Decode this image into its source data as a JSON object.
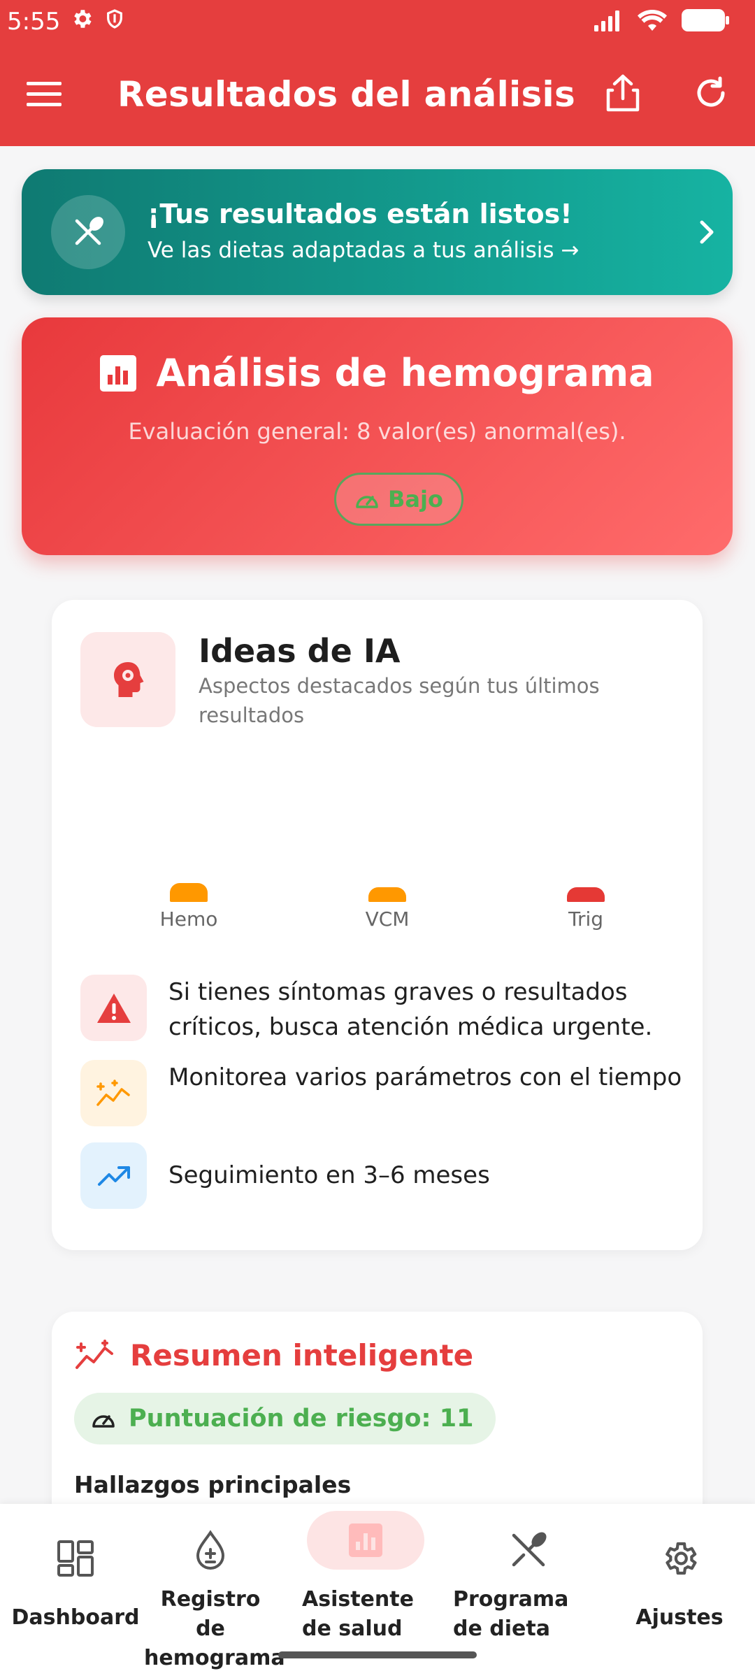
{
  "status_bar": {
    "time": "5:55"
  },
  "app_bar": {
    "title": "Resultados del análisis"
  },
  "banner": {
    "title": "¡Tus resultados están listos!",
    "subtitle": "Ve las dietas adaptadas a tus análisis →"
  },
  "analysis_card": {
    "title": "Análisis de hemograma",
    "subtitle": "Evaluación general: 8 valor(es) anormal(es).",
    "badge": "Bajo"
  },
  "ai_ideas": {
    "title": "Ideas de IA",
    "subtitle": "Aspectos destacados según tus últimos resultados",
    "chart_data": {
      "type": "bar",
      "categories": [
        "Hemo",
        "VCM",
        "Trig"
      ],
      "values": [
        0.45,
        0.35,
        0.35
      ],
      "colors": [
        "#ff9800",
        "#ff9800",
        "#e53935"
      ]
    },
    "tips": [
      {
        "icon": "warning-icon",
        "text": "Si tienes síntomas graves o resultados críticos, busca atención médica urgente."
      },
      {
        "icon": "trend-sparkle-icon",
        "text": "Monitorea varios parámetros con el tiempo"
      },
      {
        "icon": "trending-up-icon",
        "text": "Seguimiento en 3–6 meses"
      }
    ]
  },
  "smart_summary": {
    "title": "Resumen inteligente",
    "risk_score": "Puntuación de riesgo: 11",
    "findings_heading": "Hallazgos principales"
  },
  "bottom_nav": {
    "items": [
      {
        "label": "Dashboard",
        "icon": "dashboard-icon"
      },
      {
        "label": "Registro de hemograma",
        "icon": "blood-drop-icon"
      },
      {
        "label": "Asistente de salud",
        "icon": "chart-icon"
      },
      {
        "label": "Programa de dieta",
        "icon": "fork-knife-icon"
      },
      {
        "label": "Ajustes",
        "icon": "gear-icon"
      }
    ],
    "active_index": 2
  },
  "colors": {
    "primary": "#e53e3e",
    "teal_start": "#0f7a72",
    "teal_end": "#16b3a2",
    "success": "#4caf50",
    "warning": "#ff9800"
  }
}
